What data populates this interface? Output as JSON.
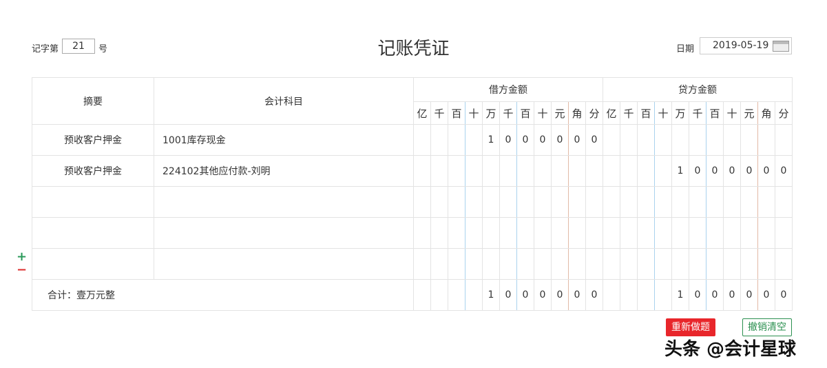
{
  "header": {
    "no_label": "记字第",
    "no_value": "21",
    "no_suffix": "号",
    "title": "记账凭证",
    "date_label": "日期",
    "date_value": "2019-05-19"
  },
  "table": {
    "col_summary": "摘要",
    "col_account": "会计科目",
    "debit": "借方金额",
    "credit": "贷方金额",
    "units": [
      "亿",
      "千",
      "百",
      "十",
      "万",
      "千",
      "百",
      "十",
      "元",
      "角",
      "分"
    ],
    "rows": [
      {
        "summary": "预收客户押金",
        "account": "1001库存现金",
        "debit": [
          "",
          "",
          "",
          "",
          "1",
          "0",
          "0",
          "0",
          "0",
          "0",
          "0"
        ],
        "credit": [
          "",
          "",
          "",
          "",
          "",
          "",
          "",
          "",
          "",
          "",
          ""
        ]
      },
      {
        "summary": "预收客户押金",
        "account": "224102其他应付款-刘明",
        "debit": [
          "",
          "",
          "",
          "",
          "",
          "",
          "",
          "",
          "",
          "",
          ""
        ],
        "credit": [
          "",
          "",
          "",
          "",
          "1",
          "0",
          "0",
          "0",
          "0",
          "0",
          "0"
        ]
      },
      {
        "summary": "",
        "account": "",
        "debit": [
          "",
          "",
          "",
          "",
          "",
          "",
          "",
          "",
          "",
          "",
          ""
        ],
        "credit": [
          "",
          "",
          "",
          "",
          "",
          "",
          "",
          "",
          "",
          "",
          ""
        ]
      },
      {
        "summary": "",
        "account": "",
        "debit": [
          "",
          "",
          "",
          "",
          "",
          "",
          "",
          "",
          "",
          "",
          ""
        ],
        "credit": [
          "",
          "",
          "",
          "",
          "",
          "",
          "",
          "",
          "",
          "",
          ""
        ]
      },
      {
        "summary": "",
        "account": "",
        "debit": [
          "",
          "",
          "",
          "",
          "",
          "",
          "",
          "",
          "",
          "",
          ""
        ],
        "credit": [
          "",
          "",
          "",
          "",
          "",
          "",
          "",
          "",
          "",
          "",
          ""
        ]
      }
    ],
    "total": {
      "label": "合计：壹万元整",
      "debit": [
        "",
        "",
        "",
        "",
        "1",
        "0",
        "0",
        "0",
        "0",
        "0",
        "0"
      ],
      "credit": [
        "",
        "",
        "",
        "",
        "1",
        "0",
        "0",
        "0",
        "0",
        "0",
        "0"
      ]
    }
  },
  "controls": {
    "add": "+",
    "remove": "−",
    "redo": "重新做题",
    "undo": "撤销清空"
  },
  "watermark": "头条 @会计星球"
}
